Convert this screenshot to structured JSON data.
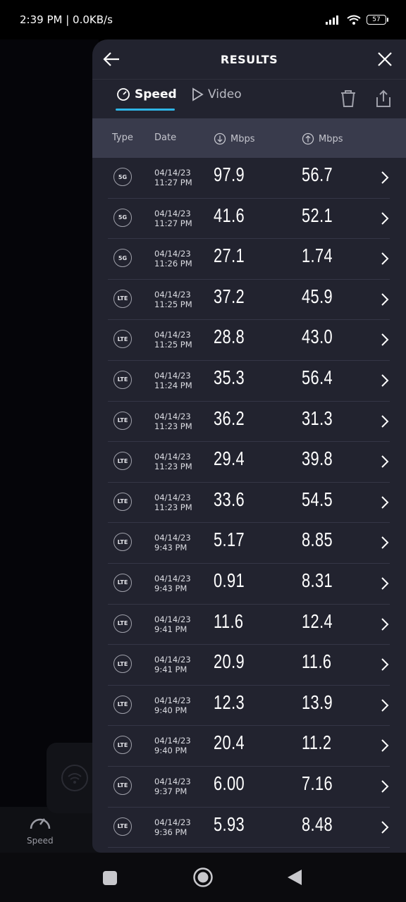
{
  "status": {
    "time": "2:39 PM | 0.0KB/s",
    "battery": "57"
  },
  "background": {
    "nav_speed_label": "Speed"
  },
  "header": {
    "title": "RESULTS"
  },
  "tabs": {
    "speed": "Speed",
    "video": "Video"
  },
  "columns": {
    "type": "Type",
    "date": "Date",
    "down": "Mbps",
    "up": "Mbps"
  },
  "rows": [
    {
      "type": "5G",
      "date": "04/14/23",
      "time": "11:27 PM",
      "down": "97.9",
      "up": "56.7"
    },
    {
      "type": "5G",
      "date": "04/14/23",
      "time": "11:27 PM",
      "down": "41.6",
      "up": "52.1"
    },
    {
      "type": "5G",
      "date": "04/14/23",
      "time": "11:26 PM",
      "down": "27.1",
      "up": "1.74"
    },
    {
      "type": "LTE",
      "date": "04/14/23",
      "time": "11:25 PM",
      "down": "37.2",
      "up": "45.9"
    },
    {
      "type": "LTE",
      "date": "04/14/23",
      "time": "11:25 PM",
      "down": "28.8",
      "up": "43.0"
    },
    {
      "type": "LTE",
      "date": "04/14/23",
      "time": "11:24 PM",
      "down": "35.3",
      "up": "56.4"
    },
    {
      "type": "LTE",
      "date": "04/14/23",
      "time": "11:23 PM",
      "down": "36.2",
      "up": "31.3"
    },
    {
      "type": "LTE",
      "date": "04/14/23",
      "time": "11:23 PM",
      "down": "29.4",
      "up": "39.8"
    },
    {
      "type": "LTE",
      "date": "04/14/23",
      "time": "11:23 PM",
      "down": "33.6",
      "up": "54.5"
    },
    {
      "type": "LTE",
      "date": "04/14/23",
      "time": "9:43 PM",
      "down": "5.17",
      "up": "8.85"
    },
    {
      "type": "LTE",
      "date": "04/14/23",
      "time": "9:43 PM",
      "down": "0.91",
      "up": "8.31"
    },
    {
      "type": "LTE",
      "date": "04/14/23",
      "time": "9:41 PM",
      "down": "11.6",
      "up": "12.4"
    },
    {
      "type": "LTE",
      "date": "04/14/23",
      "time": "9:41 PM",
      "down": "20.9",
      "up": "11.6"
    },
    {
      "type": "LTE",
      "date": "04/14/23",
      "time": "9:40 PM",
      "down": "12.3",
      "up": "13.9"
    },
    {
      "type": "LTE",
      "date": "04/14/23",
      "time": "9:40 PM",
      "down": "20.4",
      "up": "11.2"
    },
    {
      "type": "LTE",
      "date": "04/14/23",
      "time": "9:37 PM",
      "down": "6.00",
      "up": "7.16"
    },
    {
      "type": "LTE",
      "date": "04/14/23",
      "time": "9:36 PM",
      "down": "5.93",
      "up": "8.48"
    }
  ],
  "colors": {
    "accent": "#2fb5e6",
    "panel": "#22232f",
    "header_row": "#393b4c"
  }
}
